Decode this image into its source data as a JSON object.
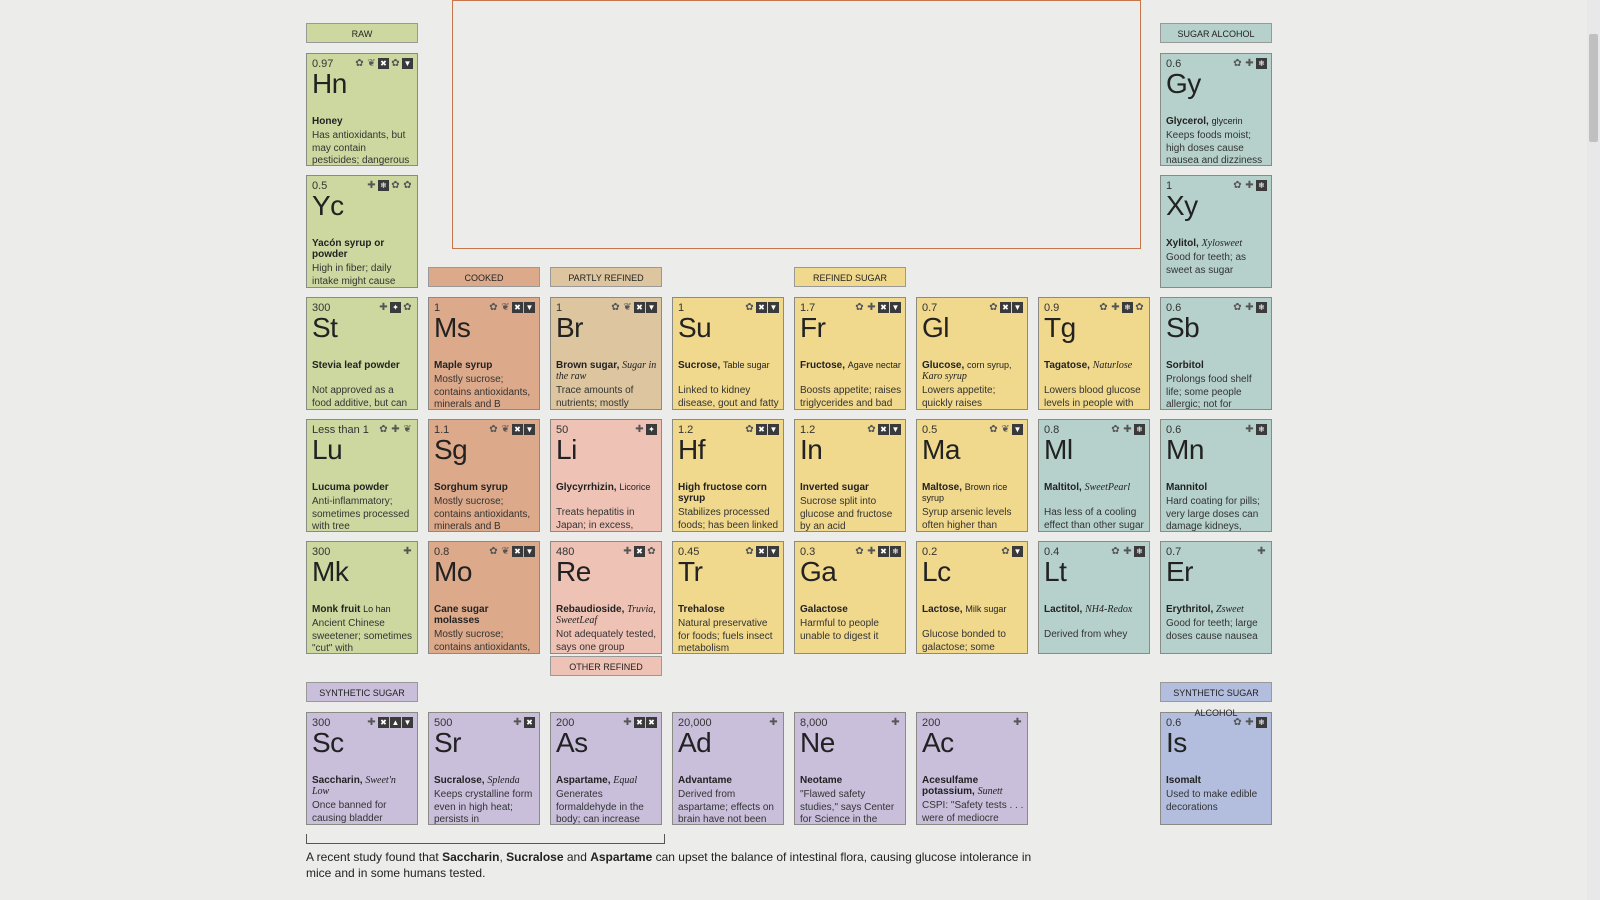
{
  "colors": {
    "raw": "#cdd8a0",
    "cooked": "#dca98a",
    "partly_refined": "#dcc59f",
    "licorice": "#eec2b5",
    "refined": "#f0d88c",
    "sugar_alcohol": "#b6d1cb",
    "synthetic": "#c9bfdb",
    "synthetic_alcohol": "#b3bedf",
    "big_box_border": "#c8754b"
  },
  "categories": [
    {
      "id": "raw",
      "label": "RAW",
      "color": "raw"
    },
    {
      "id": "sugar-alcohol",
      "label": "SUGAR ALCOHOL",
      "color": "sugar_alcohol"
    },
    {
      "id": "cooked",
      "label": "COOKED",
      "color": "cooked"
    },
    {
      "id": "partly-refined",
      "label": "PARTLY REFINED",
      "color": "partly_refined"
    },
    {
      "id": "refined-sugar",
      "label": "REFINED SUGAR",
      "color": "refined"
    },
    {
      "id": "other-refined",
      "label": "OTHER REFINED",
      "color": "licorice"
    },
    {
      "id": "synthetic-sugar",
      "label": "SYNTHETIC SUGAR",
      "color": "synthetic"
    },
    {
      "id": "synthetic-sugar-alcohol",
      "label": "SYNTHETIC SUGAR ALCOHOL",
      "color": "synthetic_alcohol"
    }
  ],
  "elements": [
    {
      "id": "hn",
      "gi": "0.97",
      "symbol": "Hn",
      "name": "Honey",
      "alt": "",
      "alt_italic": "",
      "desc": "Has antioxidants, but may contain pesticides; dangerous",
      "color": "raw",
      "icons": [
        "gear",
        "bee",
        "box-x",
        "gear",
        "box-down"
      ]
    },
    {
      "id": "yc",
      "gi": "0.5",
      "symbol": "Yc",
      "name": "Yacón syrup or powder",
      "alt": "",
      "alt_italic": "",
      "desc": "High in fiber; daily intake might cause",
      "color": "raw",
      "icons": [
        "plus",
        "box-snow",
        "gear",
        "gear"
      ]
    },
    {
      "id": "st",
      "gi": "300",
      "symbol": "St",
      "name": "Stevia leaf powder",
      "alt": "",
      "alt_italic": "",
      "desc": "Not approved as a food additive, but can be bought as a",
      "color": "raw",
      "icons": [
        "plus",
        "box-leaf",
        "gear"
      ]
    },
    {
      "id": "lu",
      "gi": "Less than 1",
      "symbol": "Lu",
      "name": "Lucuma powder",
      "alt": "",
      "alt_italic": "",
      "desc": "Anti-inflammatory; sometimes processed with tree",
      "color": "raw",
      "icons": [
        "gear",
        "plus",
        "bee"
      ]
    },
    {
      "id": "mk",
      "gi": "300",
      "symbol": "Mk",
      "name": "Monk fruit",
      "alt": "Lo han",
      "alt_italic": "",
      "desc": "Ancient Chinese sweetener; sometimes \"cut\" with",
      "color": "raw",
      "icons": [
        "plus"
      ]
    },
    {
      "id": "ms",
      "gi": "1",
      "symbol": "Ms",
      "name": "Maple syrup",
      "alt": "",
      "alt_italic": "",
      "desc": "Mostly sucrose; contains antioxidants, minerals and B",
      "color": "cooked",
      "icons": [
        "gear",
        "bee",
        "box-x",
        "box-down"
      ]
    },
    {
      "id": "sg",
      "gi": "1.1",
      "symbol": "Sg",
      "name": "Sorghum syrup",
      "alt": "",
      "alt_italic": "",
      "desc": "Mostly sucrose; contains antioxidants, minerals and B",
      "color": "cooked",
      "icons": [
        "gear",
        "bee",
        "box-x",
        "box-down"
      ]
    },
    {
      "id": "mo",
      "gi": "0.8",
      "symbol": "Mo",
      "name": "Cane sugar molasses",
      "alt": "",
      "alt_italic": "",
      "desc": "Mostly sucrose; contains antioxidants, minerals and B",
      "color": "cooked",
      "icons": [
        "gear",
        "bee",
        "box-x",
        "box-down"
      ]
    },
    {
      "id": "br",
      "gi": "1",
      "symbol": "Br",
      "name": "Brown sugar,",
      "alt": "",
      "alt_italic": "Sugar in the raw",
      "desc": "Trace amounts of nutrients; mostly",
      "color": "partly_refined",
      "icons": [
        "gear",
        "bee",
        "box-x",
        "box-down"
      ]
    },
    {
      "id": "li",
      "gi": "50",
      "symbol": "Li",
      "name": "Glycyrrhizin,",
      "alt": "Licorice",
      "alt_italic": "",
      "desc": "Treats hepatitis in Japan; in excess, might cause high",
      "color": "licorice",
      "icons": [
        "plus",
        "box-leaf"
      ]
    },
    {
      "id": "re",
      "gi": "480",
      "symbol": "Re",
      "name": "Rebaudioside,",
      "alt": "",
      "alt_italic": "Truvia, SweetLeaf",
      "desc": "Not adequately tested, says one group",
      "color": "licorice",
      "icons": [
        "plus",
        "box-x",
        "gear"
      ]
    },
    {
      "id": "su",
      "gi": "1",
      "symbol": "Su",
      "name": "Sucrose,",
      "alt": "Table sugar",
      "alt_italic": "",
      "desc": "Linked to kidney disease, gout and fatty liver disease",
      "color": "refined",
      "icons": [
        "gear",
        "box-x",
        "box-down"
      ]
    },
    {
      "id": "hf",
      "gi": "1.2",
      "symbol": "Hf",
      "name": "High fructose corn syrup",
      "alt": "",
      "alt_italic": "",
      "desc": "Stabilizes processed foods; has been linked",
      "color": "refined",
      "icons": [
        "gear",
        "box-x",
        "box-down"
      ]
    },
    {
      "id": "tr",
      "gi": "0.45",
      "symbol": "Tr",
      "name": "Trehalose",
      "alt": "",
      "alt_italic": "",
      "desc": "Natural preservative for foods; fuels insect metabolism",
      "color": "refined",
      "icons": [
        "gear",
        "box-x",
        "box-down"
      ]
    },
    {
      "id": "fr",
      "gi": "1.7",
      "symbol": "Fr",
      "name": "Fructose,",
      "alt": "Agave nectar",
      "alt_italic": "",
      "desc": "Boosts appetite; raises triglycerides and bad cholesterol",
      "color": "refined",
      "icons": [
        "gear",
        "plus",
        "box-x",
        "box-down"
      ]
    },
    {
      "id": "in",
      "gi": "1.2",
      "symbol": "In",
      "name": "Inverted sugar",
      "alt": "",
      "alt_italic": "",
      "desc": "Sucrose split into glucose and fructose by an acid",
      "color": "refined",
      "icons": [
        "gear",
        "box-x",
        "box-down"
      ]
    },
    {
      "id": "ga",
      "gi": "0.3",
      "symbol": "Ga",
      "name": "Galactose",
      "alt": "",
      "alt_italic": "",
      "desc": "Harmful to people unable to digest it",
      "color": "refined",
      "icons": [
        "gear",
        "plus",
        "box-x",
        "box-snow"
      ]
    },
    {
      "id": "gl",
      "gi": "0.7",
      "symbol": "Gl",
      "name": "Glucose,",
      "alt": "corn syrup,",
      "alt_italic": "Karo syrup",
      "desc": "Lowers appetite; quickly raises",
      "color": "refined",
      "icons": [
        "gear",
        "box-x",
        "box-down"
      ]
    },
    {
      "id": "ma",
      "gi": "0.5",
      "symbol": "Ma",
      "name": "Maltose,",
      "alt": "Brown rice syrup",
      "alt_italic": "",
      "desc": "Syrup arsenic levels often higher than",
      "color": "refined",
      "icons": [
        "gear",
        "bee",
        "box-down"
      ]
    },
    {
      "id": "lc",
      "gi": "0.2",
      "symbol": "Lc",
      "name": "Lactose,",
      "alt": "Milk sugar",
      "alt_italic": "",
      "desc": "Glucose bonded to galactose; some adults cannot digest it",
      "color": "refined",
      "icons": [
        "gear",
        "box-down"
      ]
    },
    {
      "id": "tg",
      "gi": "0.9",
      "symbol": "Tg",
      "name": "Tagatose,",
      "alt": "",
      "alt_italic": "Naturlose",
      "desc": "Lowers blood glucose levels in people with elevated blood sugar",
      "color": "refined",
      "icons": [
        "gear",
        "plus",
        "box-snow",
        "gear"
      ]
    },
    {
      "id": "ml",
      "gi": "0.8",
      "symbol": "Ml",
      "name": "Maltitol,",
      "alt": "",
      "alt_italic": "SweetPearl",
      "desc": "Has less of a cooling effect than other sugar alcohols",
      "color": "sugar_alcohol",
      "icons": [
        "gear",
        "plus",
        "box-snow"
      ]
    },
    {
      "id": "lt",
      "gi": "0.4",
      "symbol": "Lt",
      "name": "Lactitol,",
      "alt": "",
      "alt_italic": "NH4-Redox",
      "desc": "Derived from whey",
      "color": "sugar_alcohol",
      "icons": [
        "gear",
        "plus",
        "box-snow"
      ]
    },
    {
      "id": "gy",
      "gi": "0.6",
      "symbol": "Gy",
      "name": "Glycerol,",
      "alt": "glycerin",
      "alt_italic": "",
      "desc": "Keeps foods moist; high doses cause nausea and dizziness",
      "color": "sugar_alcohol",
      "icons": [
        "gear",
        "plus",
        "box-snow"
      ]
    },
    {
      "id": "xy",
      "gi": "1",
      "symbol": "Xy",
      "name": "Xylitol,",
      "alt": "",
      "alt_italic": "Xylosweet",
      "desc": "Good for teeth; as sweet as sugar",
      "color": "sugar_alcohol",
      "icons": [
        "gear",
        "plus",
        "box-snow"
      ]
    },
    {
      "id": "sb",
      "gi": "0.6",
      "symbol": "Sb",
      "name": "Sorbitol",
      "alt": "",
      "alt_italic": "",
      "desc": "Prolongs food shelf life; some people allergic; not for",
      "color": "sugar_alcohol",
      "icons": [
        "gear",
        "plus",
        "box-snow"
      ]
    },
    {
      "id": "mn",
      "gi": "0.6",
      "symbol": "Mn",
      "name": "Mannitol",
      "alt": "",
      "alt_italic": "",
      "desc": "Hard coating for pills; very large doses can damage kidneys,",
      "color": "sugar_alcohol",
      "icons": [
        "plus",
        "box-snow"
      ]
    },
    {
      "id": "er",
      "gi": "0.7",
      "symbol": "Er",
      "name": "Erythritol,",
      "alt": "",
      "alt_italic": "Zsweet",
      "desc": "Good for teeth; large doses cause nausea",
      "color": "sugar_alcohol",
      "icons": [
        "plus"
      ]
    },
    {
      "id": "sc",
      "gi": "300",
      "symbol": "Sc",
      "name": "Saccharin,",
      "alt": "",
      "alt_italic": "Sweet'n Low",
      "desc": "Once banned for causing bladder",
      "color": "synthetic",
      "icons": [
        "plus",
        "box-x",
        "box-up",
        "box-down"
      ]
    },
    {
      "id": "sr",
      "gi": "500",
      "symbol": "Sr",
      "name": "Sucralose,",
      "alt": "",
      "alt_italic": "Splenda",
      "desc": "Keeps crystalline form even in high heat; persists in",
      "color": "synthetic",
      "icons": [
        "plus",
        "box-x"
      ]
    },
    {
      "id": "as",
      "gi": "200",
      "symbol": "As",
      "name": "Aspartame,",
      "alt": "",
      "alt_italic": "Equal",
      "desc": "Generates formaldehyde in the body; can increase",
      "color": "synthetic",
      "icons": [
        "plus",
        "box-x",
        "box-x"
      ]
    },
    {
      "id": "ad",
      "gi": "20,000",
      "symbol": "Ad",
      "name": "Advantame",
      "alt": "",
      "alt_italic": "",
      "desc": "Derived from aspartame; effects on brain have not been",
      "color": "synthetic",
      "icons": [
        "plus"
      ]
    },
    {
      "id": "ne",
      "gi": "8,000",
      "symbol": "Ne",
      "name": "Neotame",
      "alt": "",
      "alt_italic": "",
      "desc": "\"Flawed safety studies,\" says Center for Science in the",
      "color": "synthetic",
      "icons": [
        "plus"
      ]
    },
    {
      "id": "ac",
      "gi": "200",
      "symbol": "Ac",
      "name": "Acesulfame potassium,",
      "alt": "",
      "alt_italic": "Sunett",
      "desc": "CSPI: \"Safety tests . . . were of mediocre",
      "color": "synthetic",
      "icons": [
        "plus"
      ]
    },
    {
      "id": "is",
      "gi": "0.6",
      "symbol": "Is",
      "name": "Isomalt",
      "alt": "",
      "alt_italic": "",
      "desc": "Used to make edible decorations",
      "color": "synthetic_alcohol",
      "icons": [
        "gear",
        "plus",
        "box-snow"
      ]
    }
  ],
  "footnote": {
    "pre": "A recent study found that ",
    "b1": "Saccharin",
    "sep1": ", ",
    "b2": "Sucralose",
    "sep2": " and ",
    "b3": "Aspartame",
    "post": " can upset the balance of intestinal flora, causing glucose intolerance in mice and in some humans tested."
  }
}
